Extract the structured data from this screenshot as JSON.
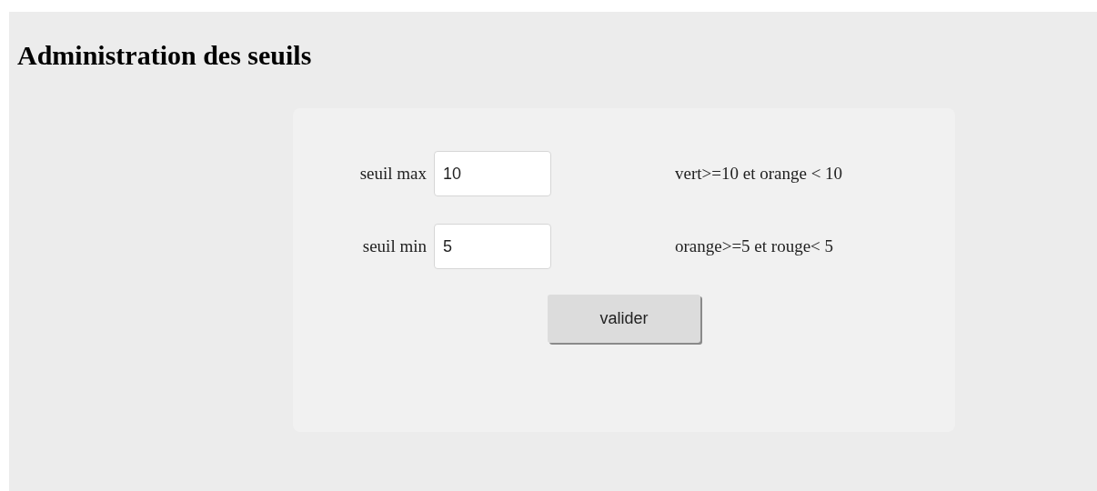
{
  "title": "Administration des seuils",
  "fields": [
    {
      "label": "seuil max",
      "value": "10",
      "hint": "vert>=10 et orange < 10"
    },
    {
      "label": "seuil min",
      "value": "5",
      "hint": "orange>=5 et rouge< 5"
    }
  ],
  "button": "valider"
}
